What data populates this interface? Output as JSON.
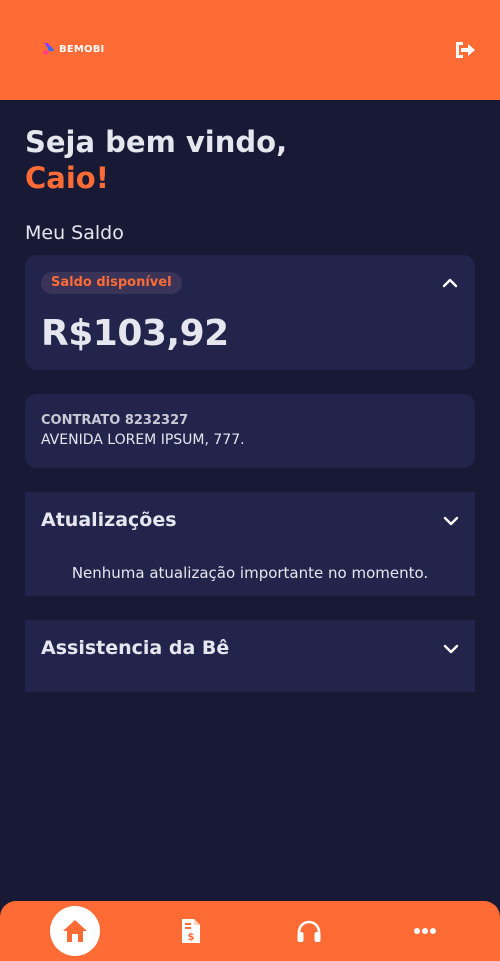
{
  "header": {
    "logo_text": "BEMOBI",
    "logout_icon": "logout-icon",
    "background_color": "#ff6b35"
  },
  "greeting": {
    "line1": "Seja bem vindo,",
    "name": "Caio!"
  },
  "balance_section": {
    "label": "Meu Saldo",
    "badge": "Saldo disponível",
    "value": "R$103,92",
    "expanded": true
  },
  "contract": {
    "title": "CONTRATO 8232327",
    "address": "AVENIDA LOREM IPSUM, 777."
  },
  "updates": {
    "title": "Atualizações",
    "empty_message": "Nenhuma atualização importante no momento."
  },
  "assistance": {
    "title": "Assistencia da Bê"
  },
  "bottom_nav": {
    "items": [
      {
        "icon": "home-icon",
        "active": true
      },
      {
        "icon": "invoice-icon",
        "active": false
      },
      {
        "icon": "headphones-icon",
        "active": false
      },
      {
        "icon": "more-icon",
        "active": false
      }
    ]
  },
  "colors": {
    "accent": "#ff6b35",
    "background": "#181935",
    "card": "#23244b"
  }
}
